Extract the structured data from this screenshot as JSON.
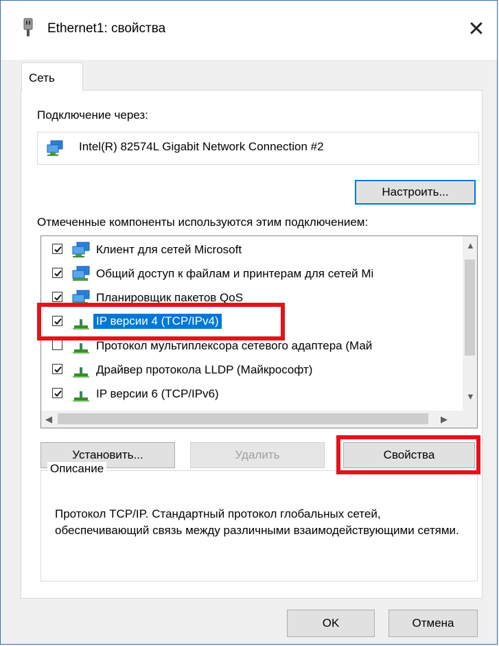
{
  "window": {
    "title": "Ethernet1: свойства",
    "close_glyph": "✕"
  },
  "tabs": [
    {
      "label": "Сеть",
      "active": true
    }
  ],
  "connection": {
    "label": "Подключение через:",
    "adapter": "Intel(R) 82574L Gigabit Network Connection #2",
    "configure_button": "Настроить..."
  },
  "components": {
    "label": "Отмеченные компоненты используются этим подключением:",
    "items": [
      {
        "label": "Клиент для сетей Microsoft",
        "checked": true,
        "icon": "network-client-icon",
        "selected": false
      },
      {
        "label": "Общий доступ к файлам и принтерам для сетей Mi",
        "checked": true,
        "icon": "network-service-icon",
        "selected": false
      },
      {
        "label": "Планировщик пакетов QoS",
        "checked": true,
        "icon": "network-service-icon",
        "selected": false
      },
      {
        "label": "IP версии 4 (TCP/IPv4)",
        "checked": true,
        "icon": "network-protocol-icon",
        "selected": true
      },
      {
        "label": "Протокол мультиплексора сетевого адаптера (Май",
        "checked": false,
        "icon": "network-protocol-icon",
        "selected": false
      },
      {
        "label": "Драйвер протокола LLDP (Майкрософт)",
        "checked": true,
        "icon": "network-protocol-icon",
        "selected": false
      },
      {
        "label": "IP версии 6 (TCP/IPv6)",
        "checked": true,
        "icon": "network-protocol-icon",
        "selected": false
      }
    ]
  },
  "buttons": {
    "install": "Установить...",
    "uninstall": "Удалить",
    "properties": "Свойства",
    "ok": "OK",
    "cancel": "Отмена"
  },
  "description": {
    "legend": "Описание",
    "text": "Протокол TCP/IP. Стандартный протокол глобальных сетей, обеспечивающий связь между различными взаимодействующими сетями."
  },
  "colors": {
    "highlight": "#e5121b",
    "selection": "#0078d7",
    "focus_border": "#0078d7"
  }
}
